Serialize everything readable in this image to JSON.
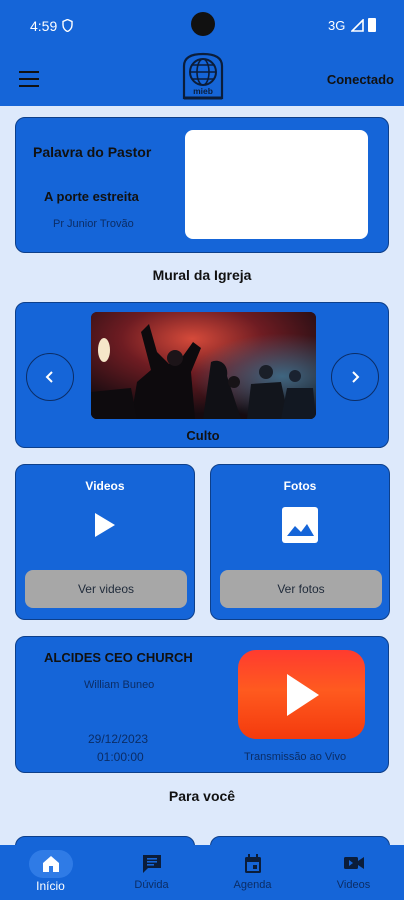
{
  "status_bar": {
    "time": "4:59",
    "network": "3G"
  },
  "app_bar": {
    "logo_text": "mieb",
    "status_label": "Conectado"
  },
  "pastor_card": {
    "title": "Palavra do Pastor",
    "subtitle": "A porte estreita",
    "author": "Pr Junior Trovão"
  },
  "mural": {
    "title": "Mural da Igreja",
    "caption": "Culto"
  },
  "videos": {
    "title": "Videos",
    "button": "Ver videos"
  },
  "fotos": {
    "title": "Fotos",
    "button": "Ver fotos"
  },
  "live": {
    "church": "ALCIDES CEO CHURCH",
    "person": "William Buneo",
    "date": "29/12/2023",
    "time": "01:00:00",
    "label": "Transmissão ao Vivo"
  },
  "para_voce": {
    "title": "Para você"
  },
  "bottom_nav": {
    "items": [
      {
        "label": "Início",
        "icon": "home-icon"
      },
      {
        "label": "Dúvida",
        "icon": "chat-icon"
      },
      {
        "label": "Agenda",
        "icon": "calendar-icon"
      },
      {
        "label": "Videos",
        "icon": "videocam-icon"
      }
    ],
    "active_index": 0
  },
  "colors": {
    "primary": "#1565d8",
    "background": "#dde9fb",
    "button_gray": "#a7a7a7",
    "youtube_red": "#ff3b2f"
  }
}
